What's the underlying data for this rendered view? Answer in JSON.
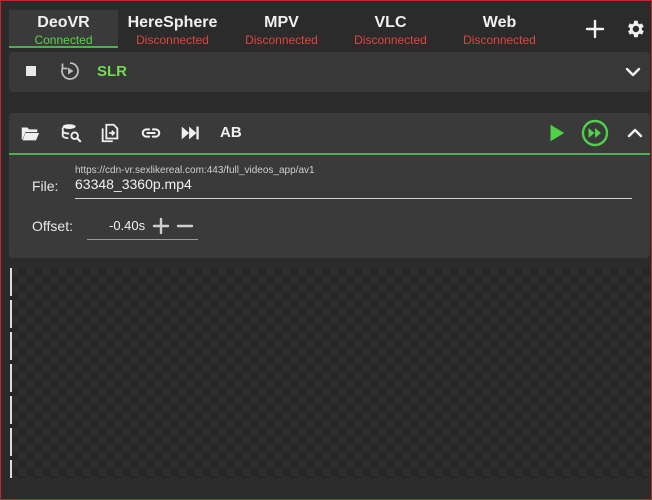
{
  "tabs": [
    {
      "name": "DeoVR",
      "status": "Connected",
      "status_color": "#5bd14a",
      "active": true
    },
    {
      "name": "HereSphere",
      "status": "Disconnected",
      "status_color": "#e0453f",
      "active": false
    },
    {
      "name": "MPV",
      "status": "Disconnected",
      "status_color": "#e0453f",
      "active": false
    },
    {
      "name": "VLC",
      "status": "Disconnected",
      "status_color": "#e0453f",
      "active": false
    },
    {
      "name": "Web",
      "status": "Disconnected",
      "status_color": "#e0453f",
      "active": false
    }
  ],
  "header_icons": [
    "add-icon",
    "gear-icon"
  ],
  "slr_bar": {
    "label": "SLR",
    "icons": [
      "stop-icon",
      "refresh-play-icon",
      "chevron-down-icon"
    ]
  },
  "toolbar": {
    "ab_label": "AB",
    "icons": [
      "folder-open-icon",
      "database-search-icon",
      "copy-file-icon",
      "link-icon",
      "skip-next-icon",
      "play-icon",
      "fast-forward-circle-icon",
      "chevron-up-icon"
    ]
  },
  "file": {
    "label": "File:",
    "url": "https://cdn-vr.sexlikereal.com:443/full_videos_app/av1",
    "name": "63348_3360p.mp4"
  },
  "offset": {
    "label": "Offset:",
    "value": "-0.40s"
  },
  "colors": {
    "accent": "#4caf50",
    "connected": "#5bd14a",
    "disconnected": "#e0453f",
    "bg": "#2b2b2b",
    "panel": "#3a3a3a"
  }
}
